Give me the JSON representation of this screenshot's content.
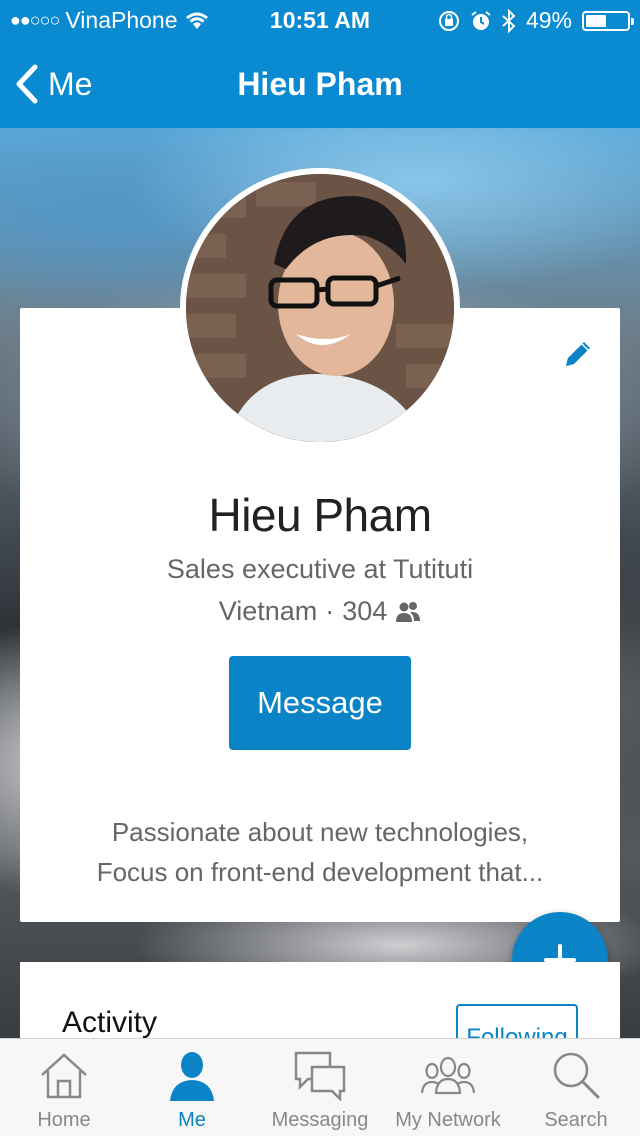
{
  "status_bar": {
    "signal": "●●○○○",
    "carrier": "VinaPhone",
    "time": "10:51 AM",
    "battery": "49%",
    "battery_level": 0.49
  },
  "nav": {
    "back_label": "Me",
    "title": "Hieu Pham"
  },
  "profile": {
    "name": "Hieu Pham",
    "headline": "Sales executive at Tutituti",
    "location": "Vietnam",
    "separator": "·",
    "connections": "304",
    "message_label": "Message",
    "summary_line1": "Passionate about new technologies,",
    "summary_line2": "Focus on front-end development that..."
  },
  "fab": {
    "label": "+"
  },
  "activity": {
    "title": "Activity",
    "following_label": "Following"
  },
  "tabs": [
    {
      "label": "Home",
      "icon": "home-icon",
      "active": false
    },
    {
      "label": "Me",
      "icon": "person-icon",
      "active": true
    },
    {
      "label": "Messaging",
      "icon": "messaging-icon",
      "active": false
    },
    {
      "label": "My Network",
      "icon": "network-icon",
      "active": false
    },
    {
      "label": "Search",
      "icon": "search-icon",
      "active": false
    }
  ],
  "colors": {
    "brand": "#0a8ad1",
    "accent": "#0a84c6",
    "tab_inactive": "#888888"
  }
}
